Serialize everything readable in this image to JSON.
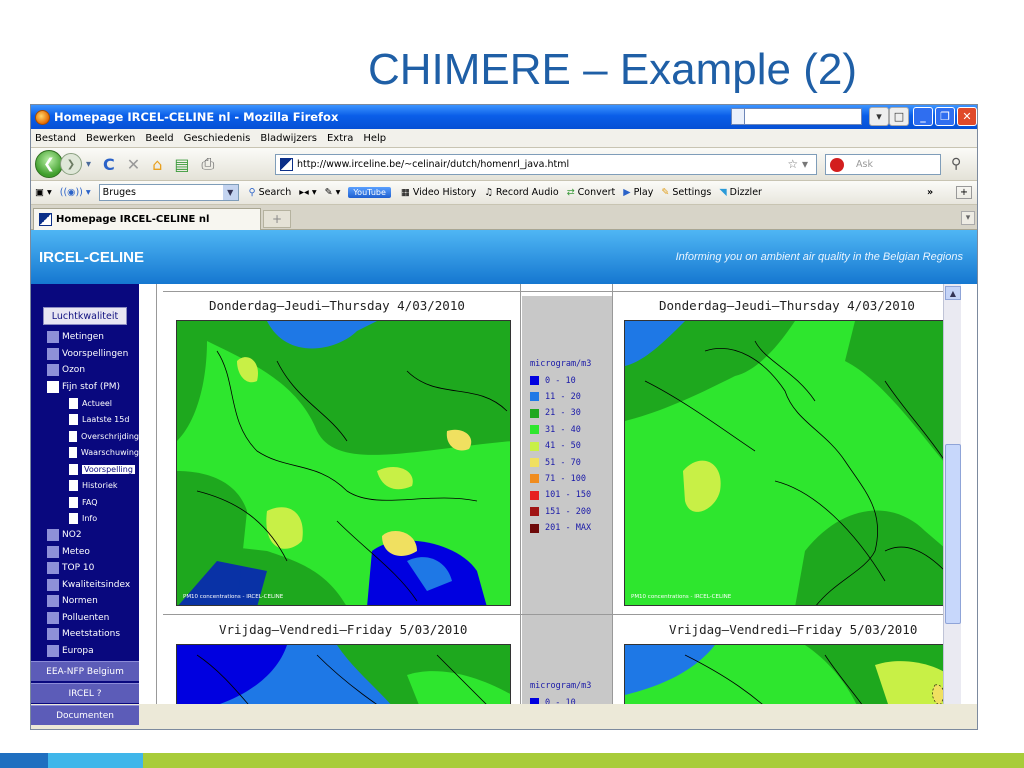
{
  "slide": {
    "title": "CHIMERE – Example (2)"
  },
  "window": {
    "title": "Homepage IRCEL-CELINE nl - Mozilla Firefox"
  },
  "menu": [
    "Bestand",
    "Bewerken",
    "Beeld",
    "Geschiedenis",
    "Bladwijzers",
    "Extra",
    "Help"
  ],
  "nav": {
    "url": "http://www.irceline.be/~celinair/dutch/homenrl_java.html",
    "search_placeholder": "Ask"
  },
  "toolbar": {
    "location": "Bruges",
    "search": "Search",
    "youtube": "YouTube",
    "video_history": "Video History",
    "record_audio": "Record Audio",
    "convert": "Convert",
    "play": "Play",
    "settings": "Settings",
    "dizzler": "Dizzler",
    "more": "»"
  },
  "tab": {
    "label": "Homepage IRCEL-CELINE nl"
  },
  "banner": {
    "left": "IRCEL-CELINE",
    "right": "Informing you on ambient air quality in the Belgian Regions"
  },
  "sidebar": {
    "top_button": "Luchtkwaliteit",
    "items_a": [
      "Metingen",
      "Voorspellingen",
      "Ozon",
      "Fijn stof (PM)"
    ],
    "subitems": [
      "Actueel",
      "Laatste 15d",
      "Overschrijding",
      "Waarschuwing",
      "Voorspelling",
      "Historiek",
      "FAQ",
      "Info"
    ],
    "items_b": [
      "NO2",
      "Meteo",
      "TOP 10",
      "Kwaliteitsindex",
      "Normen",
      "Polluenten",
      "Meetstations",
      "Europa"
    ],
    "bottom_buttons": [
      "EEA-NFP Belgium",
      "IRCEL ?",
      "Documenten"
    ]
  },
  "maps": {
    "day1_title": "Donderdag—Jeudi—Thursday  4/03/2010",
    "day2_title": "Vrijdag—Vendredi—Friday  5/03/2010",
    "caption": "PM10 concentrations - IRCEL-CELINE"
  },
  "legend": {
    "unit": "microgram/m3",
    "classes": [
      {
        "label": "0 - 10",
        "color": "#0000e0"
      },
      {
        "label": "11 - 20",
        "color": "#1e78e6"
      },
      {
        "label": "21 - 30",
        "color": "#1ea81e"
      },
      {
        "label": "31 - 40",
        "color": "#2ee62e"
      },
      {
        "label": "41 - 50",
        "color": "#c8f046"
      },
      {
        "label": "51 - 70",
        "color": "#f0e060"
      },
      {
        "label": "71 - 100",
        "color": "#f08c1e"
      },
      {
        "label": "101 - 150",
        "color": "#e61e1e"
      },
      {
        "label": "151 - 200",
        "color": "#a01414"
      },
      {
        "label": "201 - MAX",
        "color": "#6e0a0a"
      }
    ]
  },
  "colors": {
    "slide_title": "#1f5fa6",
    "sidebar": "#09087e",
    "banner": "#1577d0"
  }
}
